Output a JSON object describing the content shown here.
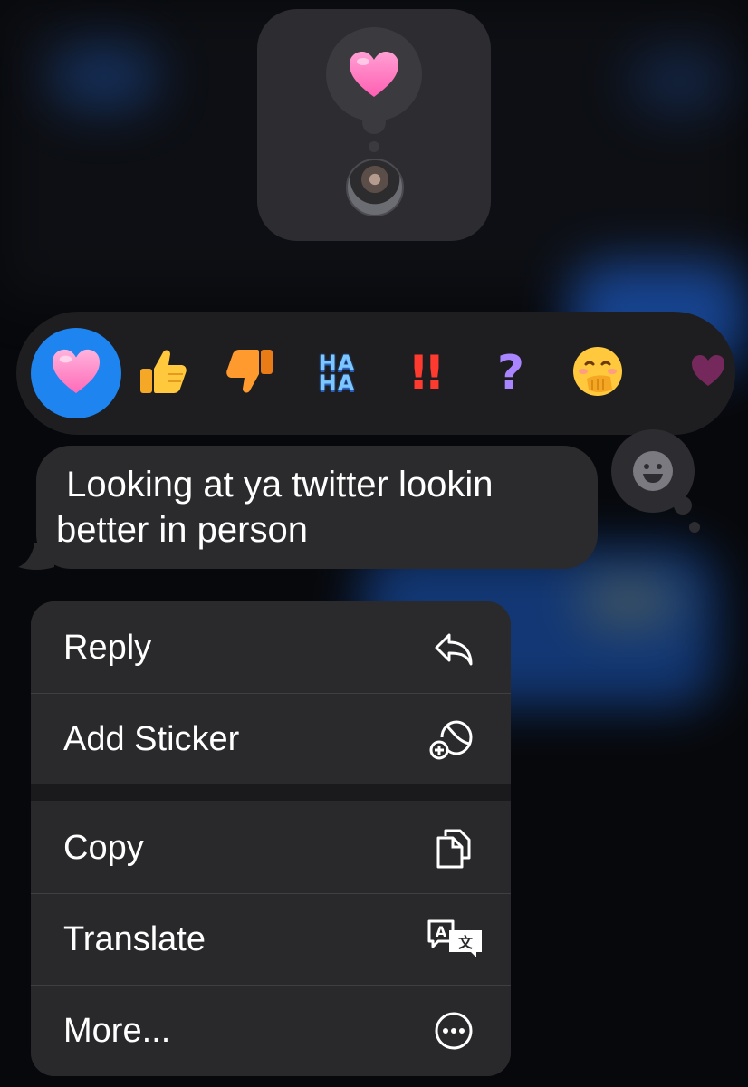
{
  "reaction_card": {
    "reaction": "pink-heart",
    "reactor": "contact-avatar"
  },
  "tapbacks": [
    {
      "name": "heart",
      "selected": true
    },
    {
      "name": "thumbs-up"
    },
    {
      "name": "thumbs-down"
    },
    {
      "name": "haha",
      "text_top": "HA",
      "text_bottom": "HA"
    },
    {
      "name": "exclamation",
      "text": "!!"
    },
    {
      "name": "question",
      "text": "?"
    },
    {
      "name": "hand-over-mouth-emoji"
    }
  ],
  "message": {
    "text": " Looking at ya twitter lookin\nbetter in person"
  },
  "menu": {
    "items": [
      {
        "label": "Reply",
        "icon": "reply-icon"
      },
      {
        "label": "Add Sticker",
        "icon": "add-sticker-icon"
      },
      {
        "label": "Copy",
        "icon": "copy-icon"
      },
      {
        "label": "Translate",
        "icon": "translate-icon"
      },
      {
        "label": "More...",
        "icon": "more-icon"
      }
    ]
  },
  "colors": {
    "selected_tapback": "#1d84f0",
    "bubble": "#2b2b2e",
    "menu": "#2a2a2d"
  }
}
